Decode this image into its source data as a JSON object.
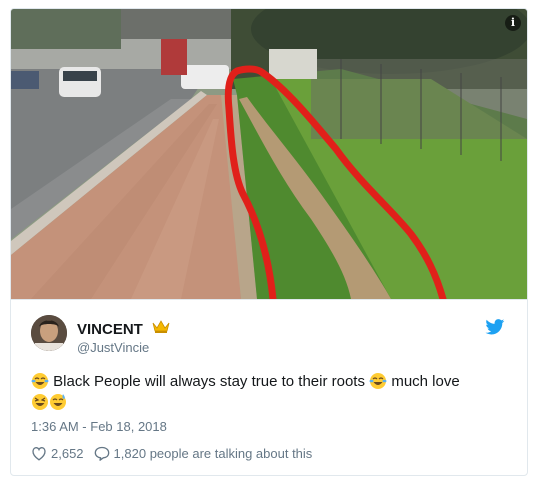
{
  "tweet": {
    "display_name": "VINCENT",
    "handle": "@JustVincie",
    "text_part1": "Black People will always stay true to their roots",
    "text_part2": "much love",
    "timestamp": "1:36 AM - Feb 18, 2018",
    "likes": "2,652",
    "replies": "1,820 people are talking about this"
  },
  "icons": {
    "info": "info-icon",
    "verified_crown": "crown-emoji",
    "bird": "twitter-bird-icon",
    "like": "heart-icon",
    "reply": "comment-icon",
    "emoji_laugh": "face-with-tears-of-joy",
    "emoji_grin": "grinning-squinting-face",
    "emoji_sweat": "grinning-face-with-sweat"
  },
  "colors": {
    "accent": "#1da1f2",
    "text": "#14171a",
    "muted": "#657786",
    "border": "#e1e8ed",
    "annotation": "#e0201a"
  }
}
